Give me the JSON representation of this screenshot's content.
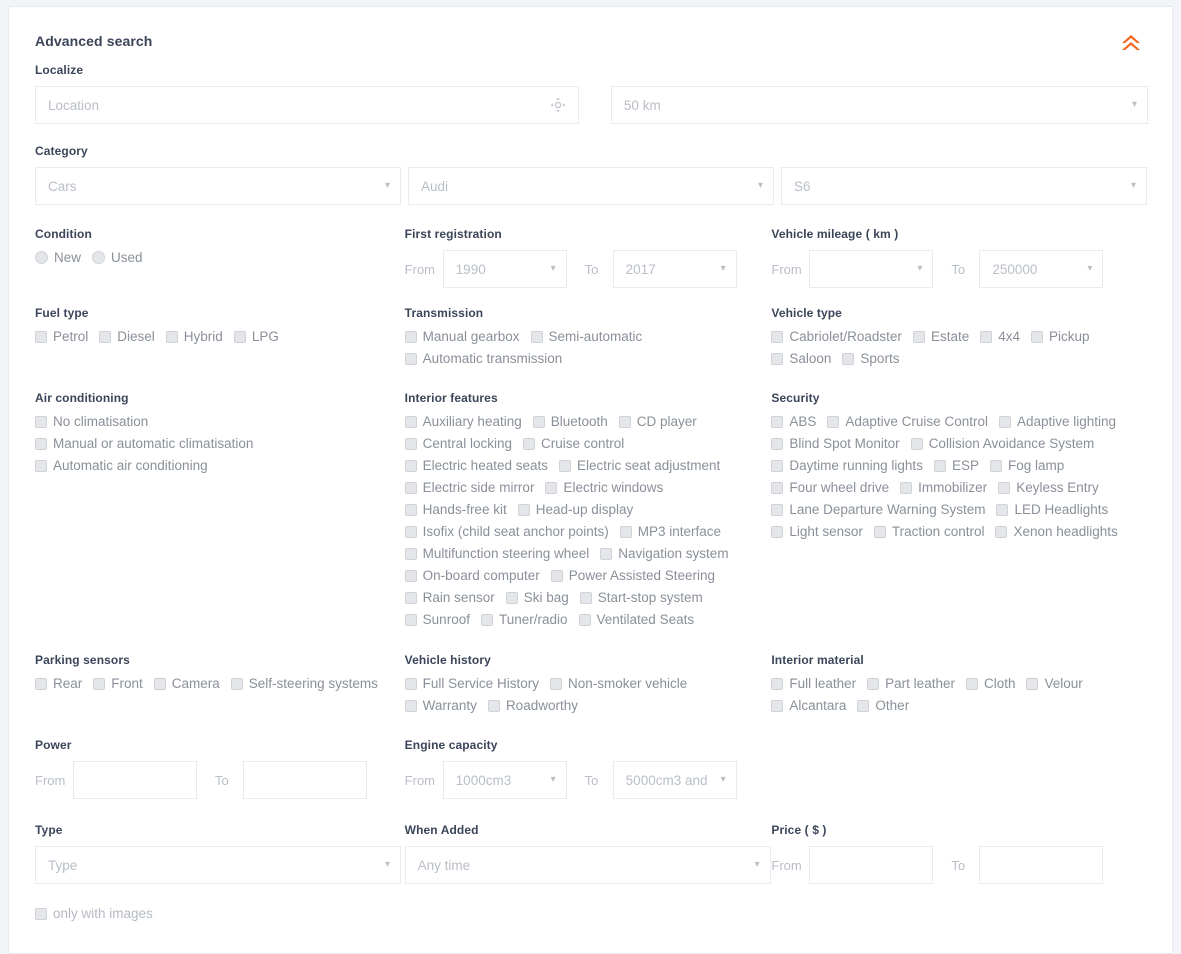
{
  "panel": {
    "title": "Advanced search",
    "collapse_icon": "double-chevron-up-icon",
    "accent_color": "#f4641e"
  },
  "localize": {
    "label": "Localize",
    "location_placeholder": "Location",
    "location_value": "",
    "geo_icon": "crosshair-locate-icon",
    "distance_value": "50 km"
  },
  "category": {
    "label": "Category",
    "type_value": "Cars",
    "make_value": "Audi",
    "model_value": "S6"
  },
  "condition": {
    "label": "Condition",
    "options": [
      "New",
      "Used"
    ]
  },
  "first_registration": {
    "label": "First registration",
    "from_label": "From",
    "to_label": "To",
    "from_value": "1990",
    "to_value": "2017"
  },
  "mileage": {
    "label": "Vehicle mileage ( km )",
    "from_label": "From",
    "to_label": "To",
    "from_value": "",
    "to_value": "250000"
  },
  "fuel_type": {
    "label": "Fuel type",
    "options": [
      "Petrol",
      "Diesel",
      "Hybrid",
      "LPG"
    ]
  },
  "transmission": {
    "label": "Transmission",
    "options": [
      "Manual gearbox",
      "Semi-automatic",
      "Automatic transmission"
    ]
  },
  "vehicle_type": {
    "label": "Vehicle type",
    "options": [
      "Cabriolet/Roadster",
      "Estate",
      "4x4",
      "Pickup",
      "Saloon",
      "Sports"
    ]
  },
  "air_conditioning": {
    "label": "Air conditioning",
    "options": [
      "No climatisation",
      "Manual or automatic climatisation",
      "Automatic air conditioning"
    ]
  },
  "interior_features": {
    "label": "Interior features",
    "options": [
      "Auxiliary heating",
      "Bluetooth",
      "CD player",
      "Central locking",
      "Cruise control",
      "Electric heated seats",
      "Electric seat adjustment",
      "Electric side mirror",
      "Electric windows",
      "Hands-free kit",
      "Head-up display",
      "Isofix (child seat anchor points)",
      "MP3 interface",
      "Multifunction steering wheel",
      "Navigation system",
      "On-board computer",
      "Power Assisted Steering",
      "Rain sensor",
      "Ski bag",
      "Start-stop system",
      "Sunroof",
      "Tuner/radio",
      "Ventilated Seats"
    ]
  },
  "security": {
    "label": "Security",
    "options": [
      "ABS",
      "Adaptive Cruise Control",
      "Adaptive lighting",
      "Blind Spot Monitor",
      "Collision Avoidance System",
      "Daytime running lights",
      "ESP",
      "Fog lamp",
      "Four wheel drive",
      "Immobilizer",
      "Keyless Entry",
      "Lane Departure Warning System",
      "LED Headlights",
      "Light sensor",
      "Traction control",
      "Xenon headlights"
    ]
  },
  "parking_sensors": {
    "label": "Parking sensors",
    "options": [
      "Rear",
      "Front",
      "Camera",
      "Self-steering systems"
    ]
  },
  "vehicle_history": {
    "label": "Vehicle history",
    "options": [
      "Full Service History",
      "Non-smoker vehicle",
      "Warranty",
      "Roadworthy"
    ]
  },
  "interior_material": {
    "label": "Interior material",
    "options": [
      "Full leather",
      "Part leather",
      "Cloth",
      "Velour",
      "Alcantara",
      "Other"
    ]
  },
  "power": {
    "label": "Power",
    "from_label": "From",
    "to_label": "To",
    "from_value": "",
    "to_value": ""
  },
  "engine_capacity": {
    "label": "Engine capacity",
    "from_label": "From",
    "to_label": "To",
    "from_value": "1000cm3",
    "to_value": "5000cm3 and"
  },
  "type": {
    "label": "Type",
    "value": "Type"
  },
  "when_added": {
    "label": "When Added",
    "value": "Any time"
  },
  "price": {
    "label": "Price ( $ )",
    "from_label": "From",
    "to_label": "To",
    "from_value": "",
    "to_value": ""
  },
  "footer": {
    "only_with_images": "only with images"
  }
}
